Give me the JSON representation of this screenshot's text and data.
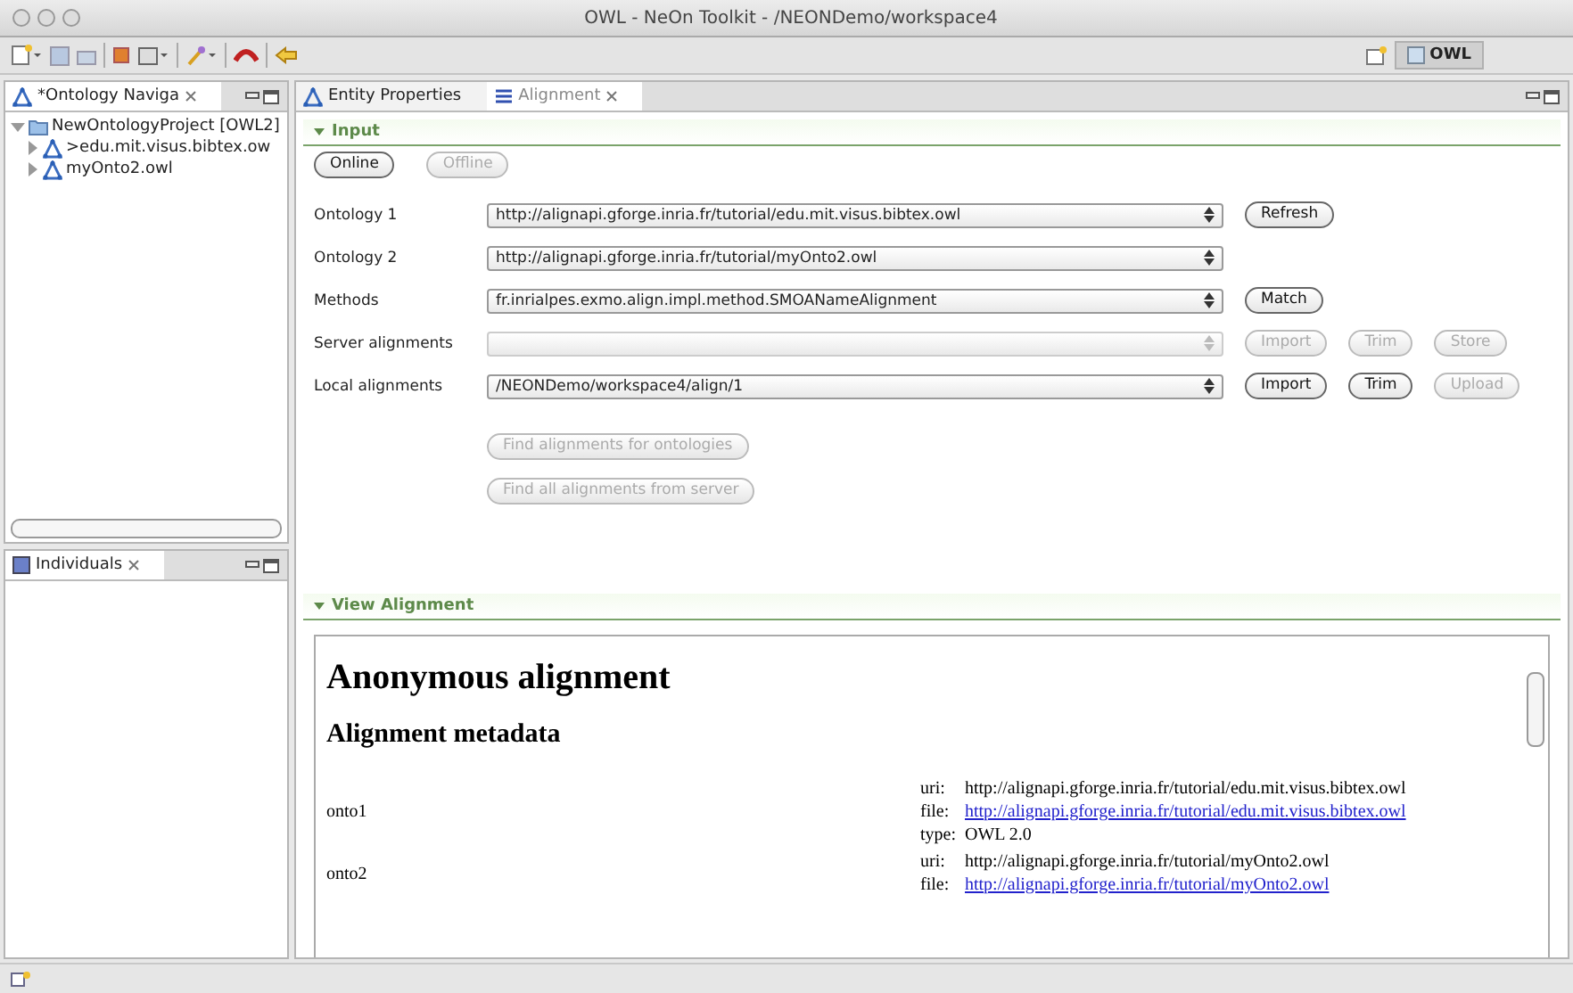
{
  "window": {
    "title": "OWL - NeOn Toolkit - /NEONDemo/workspace4"
  },
  "perspective": {
    "label": "OWL",
    "selected": true
  },
  "navigator": {
    "title": "*Ontology Naviga",
    "tree": [
      {
        "label": "NewOntologyProject [OWL2]",
        "expanded": true,
        "children": [
          {
            "label": ">edu.mit.visus.bibtex.ow",
            "expanded": false
          },
          {
            "label": "myOnto2.owl",
            "expanded": false
          }
        ]
      }
    ]
  },
  "individuals": {
    "title": "Individuals"
  },
  "editor_tabs": [
    {
      "label": "Entity Properties",
      "selected": false
    },
    {
      "label": "Alignment",
      "selected": true
    }
  ],
  "input": {
    "title": "Input",
    "expanded": true,
    "modes": [
      {
        "label": "Online",
        "disabled": false
      },
      {
        "label": "Offline",
        "disabled": true
      }
    ],
    "rows": [
      {
        "label": "Ontology 1",
        "value": "http://alignapi.gforge.inria.fr/tutorial/edu.mit.visus.bibtex.owl",
        "disabled": false,
        "buttons": [
          {
            "label": "Refresh",
            "disabled": false
          }
        ]
      },
      {
        "label": "Ontology 2",
        "value": "http://alignapi.gforge.inria.fr/tutorial/myOnto2.owl",
        "disabled": false,
        "buttons": []
      },
      {
        "label": "Methods",
        "value": "fr.inrialpes.exmo.align.impl.method.SMOANameAlignment",
        "disabled": false,
        "buttons": [
          {
            "label": "Match",
            "disabled": false
          }
        ]
      },
      {
        "label": "Server alignments",
        "disabled": true,
        "buttons": [
          {
            "label": "Import",
            "disabled": true
          },
          {
            "label": "Trim",
            "disabled": true
          },
          {
            "label": "Store",
            "disabled": true
          }
        ]
      },
      {
        "label": "Local alignments",
        "value": "/NEONDemo/workspace4/align/1",
        "disabled": false,
        "buttons": [
          {
            "label": "Import",
            "disabled": false
          },
          {
            "label": "Trim",
            "disabled": false
          },
          {
            "label": "Upload",
            "disabled": true
          }
        ]
      }
    ],
    "finders": [
      {
        "label": "Find alignments for ontologies",
        "disabled": true
      },
      {
        "label": "Find all alignments from server",
        "disabled": true
      }
    ]
  },
  "view": {
    "title": "View Alignment",
    "expanded": true,
    "heading": "Anonymous alignment",
    "subheading": "Alignment metadata",
    "entries": [
      {
        "name": "onto1",
        "fields": [
          {
            "key": "uri:",
            "value": "http://alignapi.gforge.inria.fr/tutorial/edu.mit.visus.bibtex.owl",
            "kind": "text"
          },
          {
            "key": "file:",
            "value": "http://alignapi.gforge.inria.fr/tutorial/edu.mit.visus.bibtex.owl",
            "kind": "link"
          },
          {
            "key": "type:",
            "value": "OWL 2.0",
            "kind": "text"
          }
        ]
      },
      {
        "name": "onto2",
        "fields": [
          {
            "key": "uri:",
            "value": "http://alignapi.gforge.inria.fr/tutorial/myOnto2.owl",
            "kind": "text"
          },
          {
            "key": "file:",
            "value": "http://alignapi.gforge.inria.fr/tutorial/myOnto2.owl",
            "kind": "link"
          }
        ]
      }
    ]
  }
}
